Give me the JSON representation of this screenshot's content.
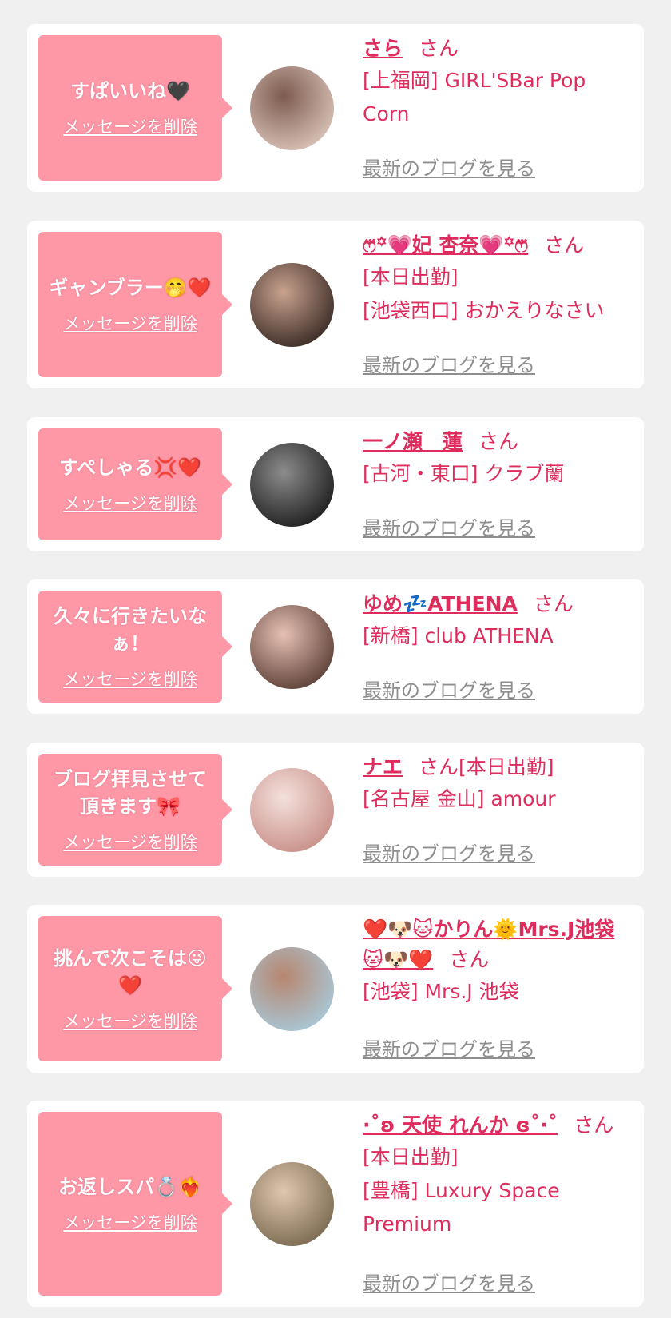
{
  "cards": [
    {
      "message": "すぱいいね🖤",
      "delete_label": "メッセージを削除",
      "name": "さら",
      "suffix": "さん",
      "lines": [
        "[上福岡] GIRL'SBar Pop",
        "Corn"
      ],
      "blog_label": "最新のブログを見る",
      "avatar_colors": [
        "#d9c2b8",
        "#7d5b4f"
      ]
    },
    {
      "message": "ギャンブラー🤭❤️",
      "delete_label": "メッセージを削除",
      "name": "ෆ⃛꙳💗妃 杏奈💗꙳ෆ⃛",
      "suffix": "さん",
      "lines": [
        "[本日出勤]",
        "[池袋西口] おかえりなさい"
      ],
      "blog_label": "最新のブログを見る",
      "avatar_colors": [
        "#3a2a25",
        "#c8a28e"
      ]
    },
    {
      "message": "すぺしゃる💢❤️",
      "delete_label": "メッセージを削除",
      "name": "一ノ瀬　蓮",
      "suffix": "さん",
      "lines": [
        "[古河・東口] クラブ蘭"
      ],
      "blog_label": "最新のブログを見る",
      "avatar_colors": [
        "#1e1e1e",
        "#8c8c8c"
      ]
    },
    {
      "message": "久々に行きたいなぁ！",
      "delete_label": "メッセージを削除",
      "name": "ゆめ💤ATHENA",
      "suffix": "さん",
      "lines": [
        "[新橋] club ATHENA"
      ],
      "blog_label": "最新のブログを見る",
      "avatar_colors": [
        "#5b3f36",
        "#e7c0b4"
      ]
    },
    {
      "message": "ブログ拝見させて頂きます🎀",
      "delete_label": "メッセージを削除",
      "name": "ナエ",
      "suffix": "さん[本日出勤]",
      "lines": [
        "[名古屋 金山] amour"
      ],
      "blog_label": "最新のブログを見る",
      "avatar_colors": [
        "#c89088",
        "#f4e0dc"
      ]
    },
    {
      "message": "挑んで次こそは😜❤️",
      "delete_label": "メッセージを削除",
      "name": "❤️🐶🐱かりん🌞Mrs.J池袋🐱🐶❤️",
      "suffix": "さん",
      "lines": [
        "[池袋] Mrs.J 池袋"
      ],
      "blog_label": "最新のブログを見る",
      "avatar_colors": [
        "#a8c8d8",
        "#b7866f"
      ]
    },
    {
      "message": "お返しスパ💍❤️‍🔥",
      "delete_label": "メッセージを削除",
      "name": "·˚ʚ 天使 れんか ɞ˚·˚",
      "suffix": "さん",
      "lines": [
        "[本日出勤]",
        "[豊橋] Luxury Space",
        "Premium"
      ],
      "blog_label": "最新のブログを見る",
      "avatar_colors": [
        "#7a6a50",
        "#e0c6b0"
      ]
    }
  ]
}
